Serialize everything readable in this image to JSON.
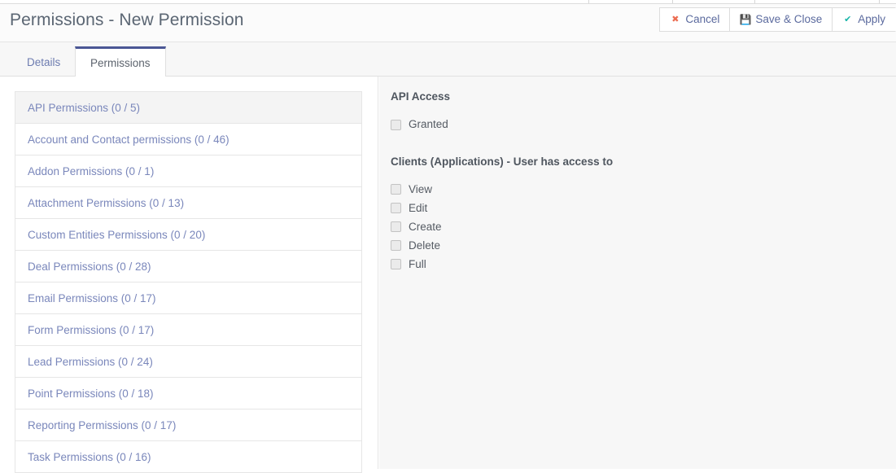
{
  "header": {
    "title": "Permissions - New Permission"
  },
  "toolbar": {
    "buttons": [
      {
        "label": "Cancel",
        "icon": "close-x-icon",
        "glyph": "✖",
        "color": "#ec6c51",
        "name": "cancel-button"
      },
      {
        "label": "Save & Close",
        "icon": "floppy-disk-icon",
        "glyph": "💾",
        "color": "#5b6a9e",
        "name": "save-and-close-button"
      },
      {
        "label": "Apply",
        "icon": "check-icon",
        "glyph": "✔",
        "color": "#18b5a8",
        "name": "apply-button"
      }
    ]
  },
  "tabs": [
    {
      "label": "Details",
      "active": false,
      "name": "tab-details"
    },
    {
      "label": "Permissions",
      "active": true,
      "name": "tab-permissions"
    }
  ],
  "permission_list": [
    {
      "label": "API Permissions (0 / 5)",
      "active": true
    },
    {
      "label": "Account and Contact permissions (0 / 46)",
      "active": false
    },
    {
      "label": "Addon Permissions (0 / 1)",
      "active": false
    },
    {
      "label": "Attachment Permissions (0 / 13)",
      "active": false
    },
    {
      "label": "Custom Entities Permissions (0 / 20)",
      "active": false
    },
    {
      "label": "Deal Permissions (0 / 28)",
      "active": false
    },
    {
      "label": "Email Permissions (0 / 17)",
      "active": false
    },
    {
      "label": "Form Permissions (0 / 17)",
      "active": false
    },
    {
      "label": "Lead Permissions (0 / 24)",
      "active": false
    },
    {
      "label": "Point Permissions (0 / 18)",
      "active": false
    },
    {
      "label": "Reporting Permissions (0 / 17)",
      "active": false
    },
    {
      "label": "Task Permissions (0 / 16)",
      "active": false
    }
  ],
  "detail_panel": {
    "api_access": {
      "title": "API Access",
      "checkboxes": [
        {
          "label": "Granted",
          "checked": false
        }
      ]
    },
    "clients": {
      "title": "Clients (Applications) - User has access to",
      "checkboxes": [
        {
          "label": "View",
          "checked": false
        },
        {
          "label": "Edit",
          "checked": false
        },
        {
          "label": "Create",
          "checked": false
        },
        {
          "label": "Delete",
          "checked": false
        },
        {
          "label": "Full",
          "checked": false
        }
      ]
    }
  },
  "colors": {
    "tab_accent": "#4a5694",
    "link": "#7a87bb",
    "panel_bg": "#f7f7f7",
    "cancel_icon": "#ec6c51",
    "apply_icon": "#18b5a8"
  }
}
